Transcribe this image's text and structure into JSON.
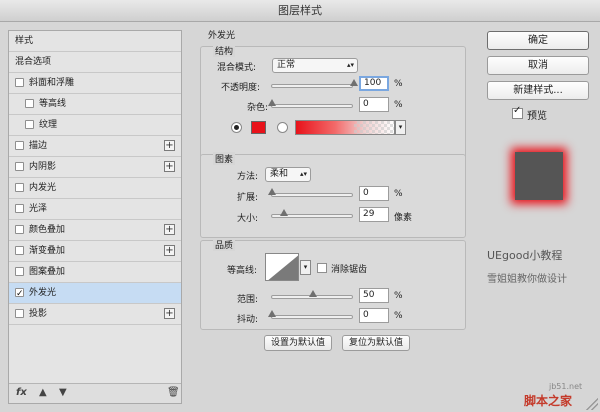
{
  "window": {
    "title": "图层样式"
  },
  "style_list": {
    "items": [
      {
        "label": "样式",
        "checkbox": false,
        "plus": false,
        "indent": false
      },
      {
        "label": "混合选项",
        "checkbox": false,
        "plus": false,
        "indent": false
      },
      {
        "label": "斜面和浮雕",
        "checkbox": true,
        "checked": false,
        "plus": false,
        "indent": false
      },
      {
        "label": "等高线",
        "checkbox": true,
        "checked": false,
        "plus": false,
        "indent": true
      },
      {
        "label": "纹理",
        "checkbox": true,
        "checked": false,
        "plus": false,
        "indent": true
      },
      {
        "label": "描边",
        "checkbox": true,
        "checked": false,
        "plus": true,
        "indent": false
      },
      {
        "label": "内阴影",
        "checkbox": true,
        "checked": false,
        "plus": true,
        "indent": false
      },
      {
        "label": "内发光",
        "checkbox": true,
        "checked": false,
        "plus": false,
        "indent": false
      },
      {
        "label": "光泽",
        "checkbox": true,
        "checked": false,
        "plus": false,
        "indent": false
      },
      {
        "label": "颜色叠加",
        "checkbox": true,
        "checked": false,
        "plus": true,
        "indent": false
      },
      {
        "label": "渐变叠加",
        "checkbox": true,
        "checked": false,
        "plus": true,
        "indent": false
      },
      {
        "label": "图案叠加",
        "checkbox": true,
        "checked": false,
        "plus": false,
        "indent": false
      },
      {
        "label": "外发光",
        "checkbox": true,
        "checked": true,
        "plus": false,
        "indent": false,
        "selected": true
      },
      {
        "label": "投影",
        "checkbox": true,
        "checked": false,
        "plus": true,
        "indent": false
      }
    ],
    "footer_fx": "fx"
  },
  "outer_glow": {
    "title": "外发光",
    "structure": {
      "title": "结构",
      "blend_mode_label": "混合模式:",
      "blend_mode_value": "正常",
      "opacity_label": "不透明度:",
      "opacity_value": "100",
      "noise_label": "杂色:",
      "noise_value": "0",
      "percent": "%",
      "glow_color": "#e8121a"
    },
    "elements": {
      "title": "图素",
      "technique_label": "方法:",
      "technique_value": "柔和",
      "spread_label": "扩展:",
      "spread_value": "0",
      "size_label": "大小:",
      "size_value": "29",
      "size_unit": "像素",
      "percent": "%"
    },
    "quality": {
      "title": "品质",
      "contour_label": "等高线:",
      "antialias_label": "消除锯齿",
      "range_label": "范围:",
      "range_value": "50",
      "jitter_label": "抖动:",
      "jitter_value": "0",
      "percent": "%"
    },
    "set_default": "设置为默认值",
    "reset_default": "复位为默认值"
  },
  "actions": {
    "ok": "确定",
    "cancel": "取消",
    "new_style": "新建样式...",
    "preview_label": "预览"
  },
  "watermark": {
    "brand": "UEgood小教程",
    "tagline": "雪姐姐教你做设计",
    "site": "jb51.net",
    "site_name": "脚本之家"
  }
}
